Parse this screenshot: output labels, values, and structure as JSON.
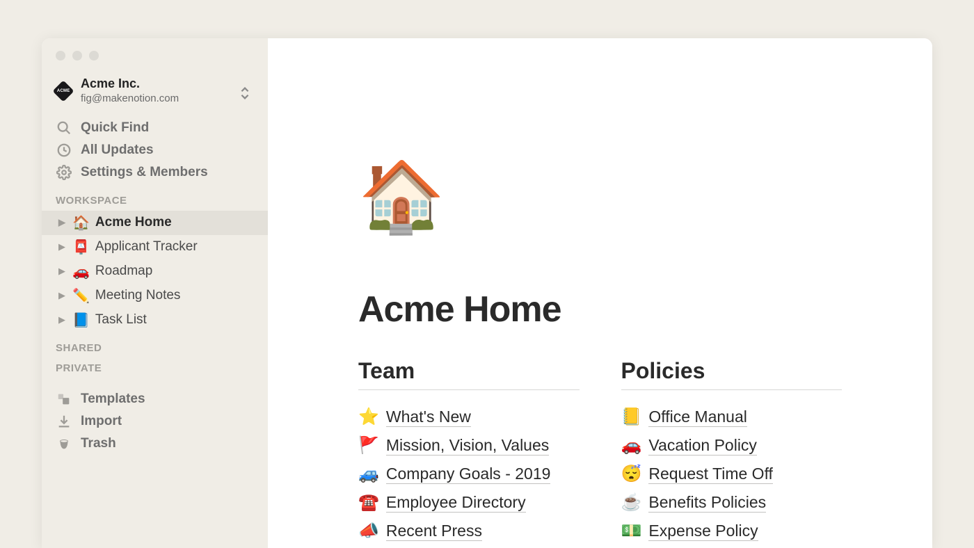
{
  "workspace": {
    "name": "Acme Inc.",
    "email": "fig@makenotion.com",
    "logo_text": "ACME"
  },
  "nav": {
    "quick_find": "Quick Find",
    "all_updates": "All Updates",
    "settings": "Settings & Members"
  },
  "sections": {
    "workspace": "WORKSPACE",
    "shared": "SHARED",
    "private": "PRIVATE"
  },
  "tree": [
    {
      "emoji": "🏠",
      "label": "Acme Home",
      "active": true
    },
    {
      "emoji": "📮",
      "label": "Applicant Tracker",
      "active": false
    },
    {
      "emoji": "🚗",
      "label": "Roadmap",
      "active": false
    },
    {
      "emoji": "✏️",
      "label": "Meeting Notes",
      "active": false
    },
    {
      "emoji": "📘",
      "label": "Task List",
      "active": false
    }
  ],
  "bottom_nav": {
    "templates": "Templates",
    "import": "Import",
    "trash": "Trash"
  },
  "page": {
    "icon": "🏠",
    "title": "Acme Home"
  },
  "columns": [
    {
      "heading": "Team",
      "links": [
        {
          "emoji": "⭐",
          "label": "What's New"
        },
        {
          "emoji": "🚩",
          "label": "Mission, Vision, Values"
        },
        {
          "emoji": "🚙",
          "label": "Company Goals - 2019"
        },
        {
          "emoji": "☎️",
          "label": "Employee Directory"
        },
        {
          "emoji": "📣",
          "label": "Recent Press"
        }
      ]
    },
    {
      "heading": "Policies",
      "links": [
        {
          "emoji": "📒",
          "label": "Office Manual"
        },
        {
          "emoji": "🚗",
          "label": "Vacation Policy"
        },
        {
          "emoji": "😴",
          "label": "Request Time Off"
        },
        {
          "emoji": "☕",
          "label": "Benefits Policies"
        },
        {
          "emoji": "💵",
          "label": "Expense Policy"
        }
      ]
    }
  ]
}
